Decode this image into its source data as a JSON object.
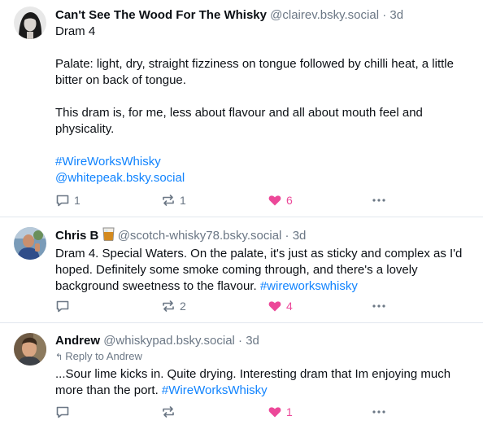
{
  "colors": {
    "link": "#1083fe",
    "muted": "#6b7785",
    "like": "#ec4899"
  },
  "posts": [
    {
      "author": "Can't See The Wood For The Whisky",
      "handle": "@clairev.bsky.social",
      "sep": "·",
      "time": "3d",
      "lines": [
        "Dram 4",
        "Palate: light, dry, straight fizziness on tongue followed by chilli heat, a little bitter on back of tongue.",
        "This dram is, for me, less about flavour and all about mouth feel and physicality."
      ],
      "hashtag": "#WireWorksWhisky",
      "mention": "@whitepeak.bsky.social",
      "replies": "1",
      "reposts": "1",
      "likes": "6"
    },
    {
      "author": "Chris B",
      "author_emoji": "whisky-tumbler",
      "handle": "@scotch-whisky78.bsky.social",
      "sep": "·",
      "time": "3d",
      "text": "Dram 4. Special Waters. On the palate, it's just as sticky and complex as I'd hoped. Definitely some smoke coming through, and there's a lovely background sweetness to the flavour.",
      "hashtag": "#wireworkswhisky",
      "replies": "",
      "reposts": "2",
      "likes": "4"
    },
    {
      "author": "Andrew",
      "handle": "@whiskypad.bsky.social",
      "sep": "·",
      "time": "3d",
      "reply_to": "Reply to Andrew",
      "text": "...Sour lime kicks in. Quite drying. Interesting dram that Im enjoying much more than the port.",
      "hashtag": "#WireWorksWhisky",
      "replies": "",
      "reposts": "",
      "likes": "1"
    }
  ],
  "icons": {
    "reply": "speech-bubble-icon",
    "repost": "repost-arrows-icon",
    "like": "heart-icon",
    "more": "ellipsis-icon"
  }
}
